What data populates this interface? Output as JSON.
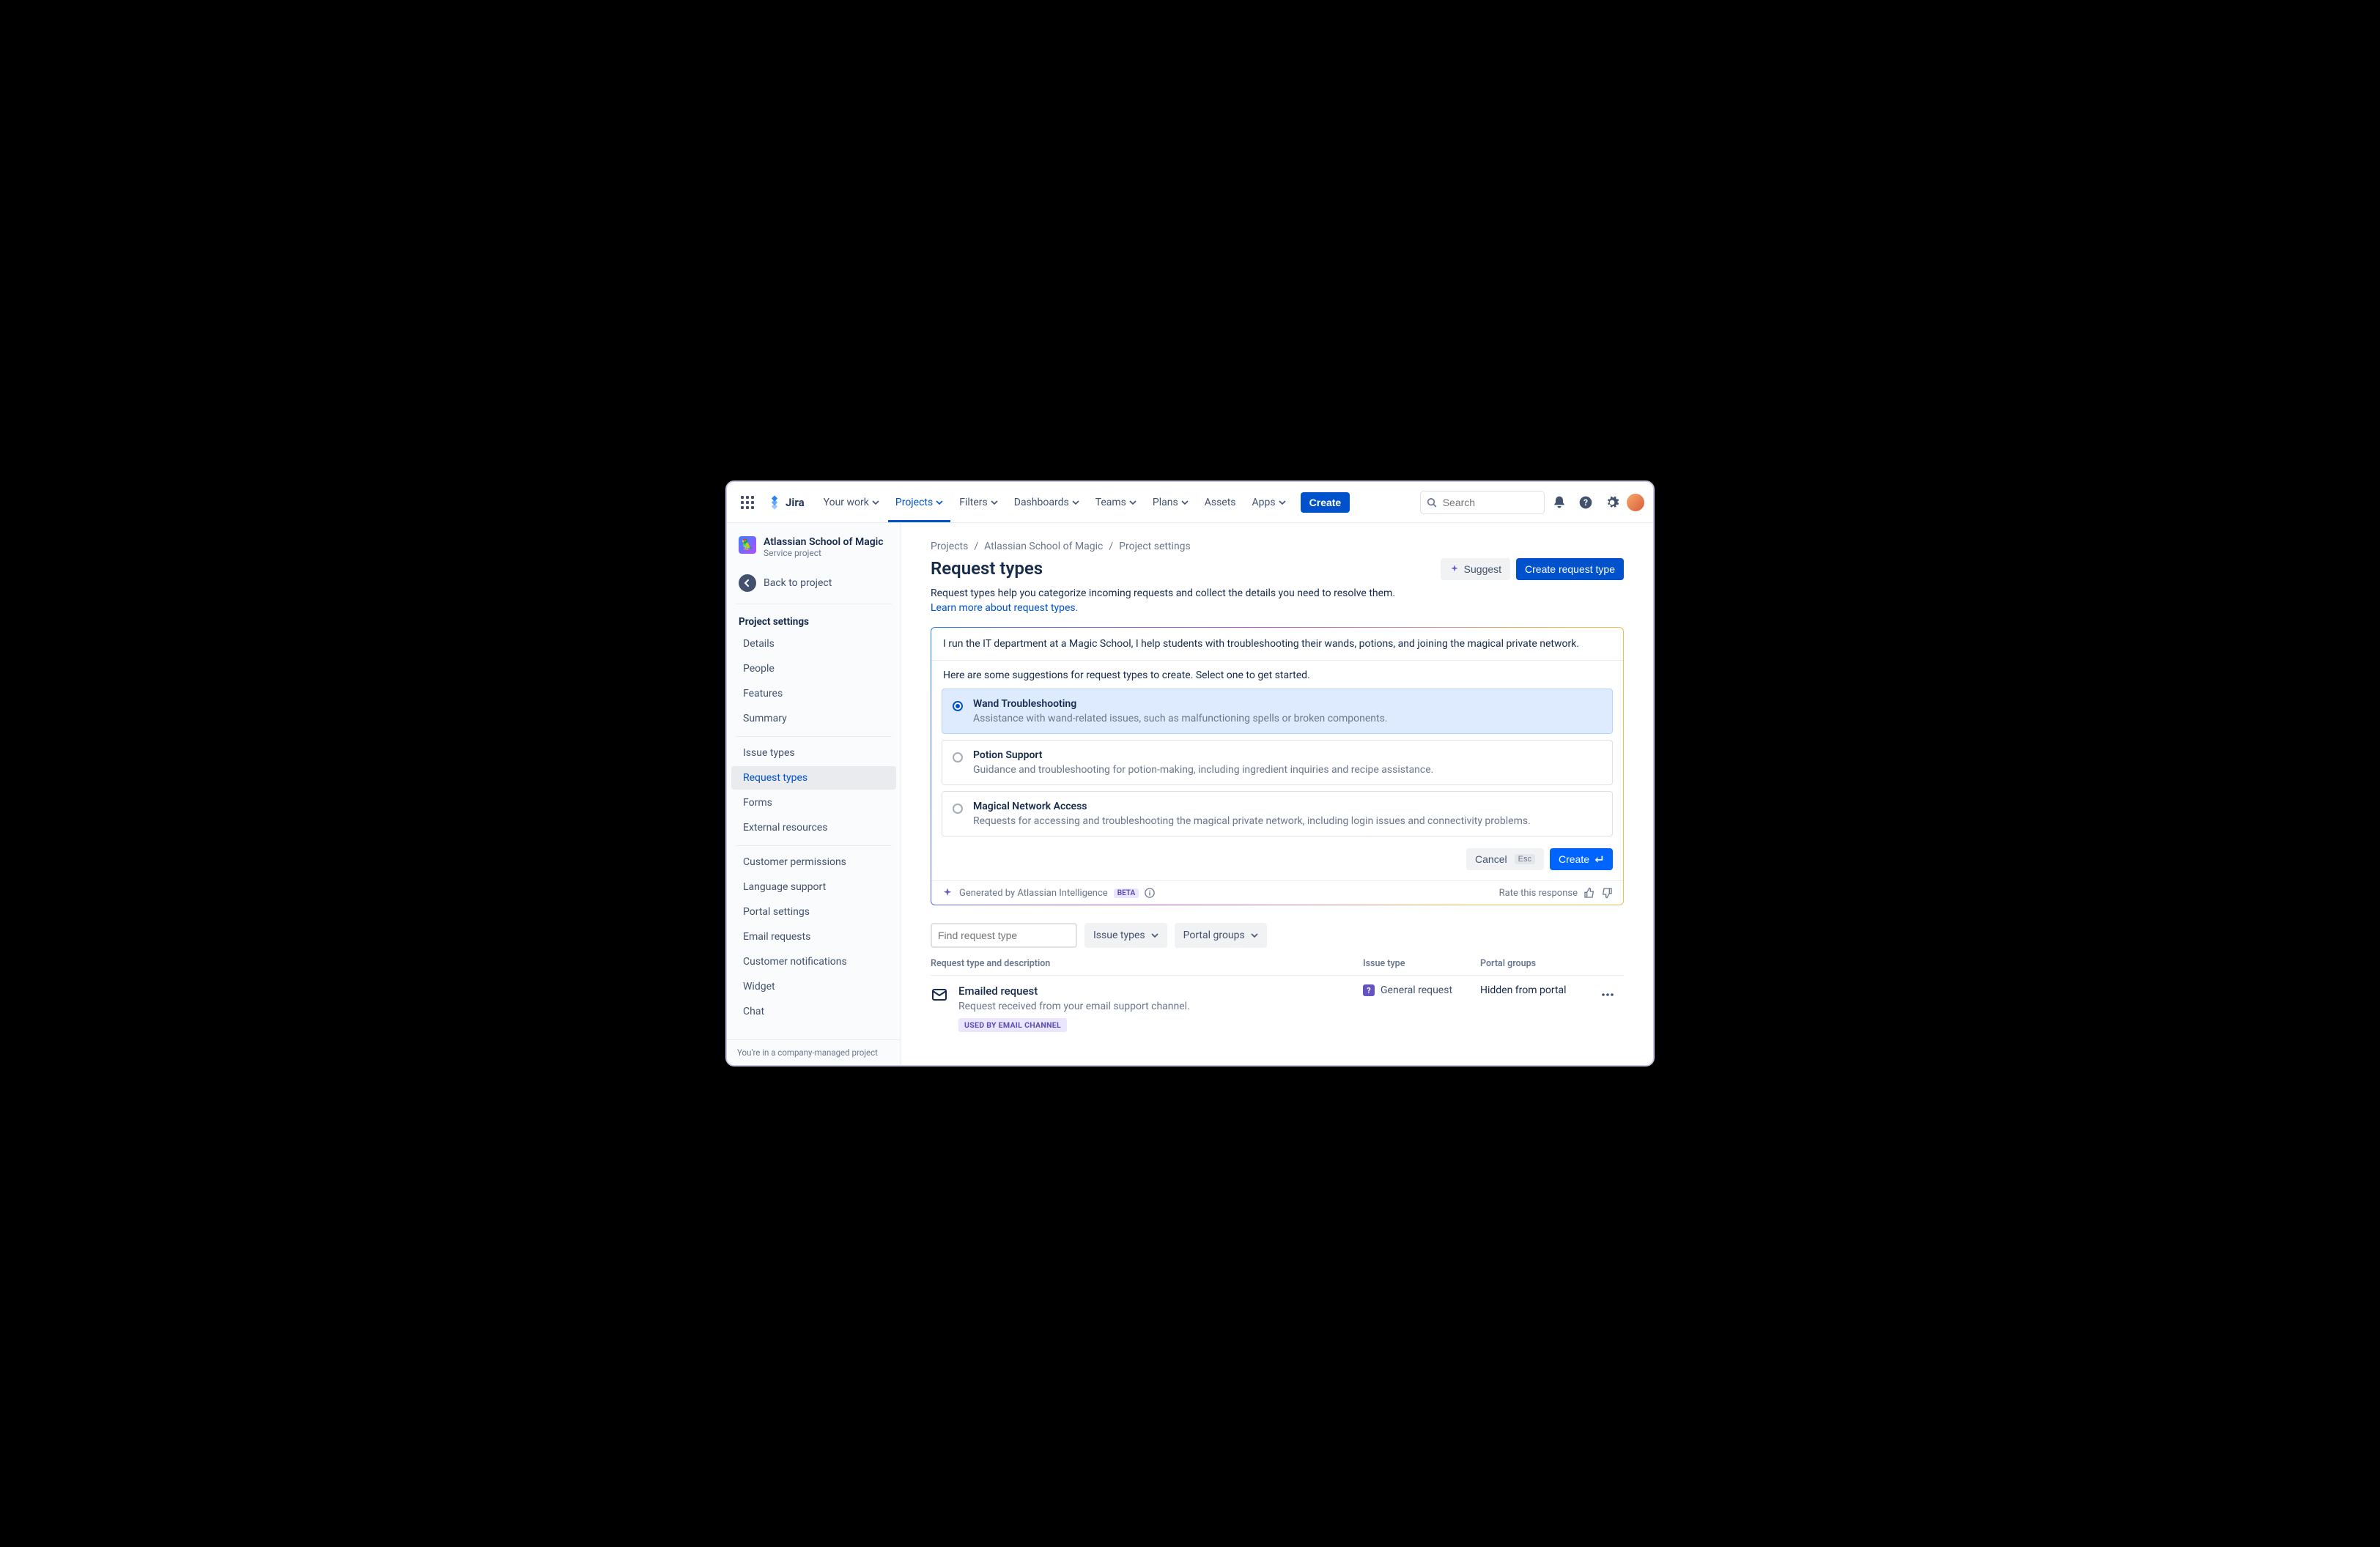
{
  "brand": "Jira",
  "search_placeholder": "Search",
  "nav": {
    "your_work": "Your work",
    "projects": "Projects",
    "filters": "Filters",
    "dashboards": "Dashboards",
    "teams": "Teams",
    "plans": "Plans",
    "assets": "Assets",
    "apps": "Apps",
    "create": "Create"
  },
  "project": {
    "name": "Atlassian School of Magic",
    "type": "Service project",
    "back": "Back to project",
    "footer": "You're in a company-managed project"
  },
  "sidebar": {
    "heading": "Project settings",
    "group1": [
      "Details",
      "People",
      "Features",
      "Summary"
    ],
    "group2": [
      "Issue types",
      "Request types",
      "Forms",
      "External resources"
    ],
    "group3": [
      "Customer permissions",
      "Language support",
      "Portal settings",
      "Email requests",
      "Customer notifications",
      "Widget",
      "Chat"
    ]
  },
  "breadcrumb": [
    "Projects",
    "Atlassian School of Magic",
    "Project settings"
  ],
  "page": {
    "title": "Request types",
    "desc": "Request types help you categorize incoming requests and collect the details you need to resolve them.",
    "learn": "Learn more about request types.",
    "suggest_btn": "Suggest",
    "create_btn": "Create request type"
  },
  "ai": {
    "prompt": "I run the IT department at a Magic School, I help students with troubleshooting their wands, potions, and joining the magical private network.",
    "subheading": "Here are some suggestions for request types to create. Select one to get started.",
    "suggestions": [
      {
        "title": "Wand Troubleshooting",
        "desc": "Assistance with wand-related issues, such as malfunctioning spells or broken components.",
        "selected": true
      },
      {
        "title": "Potion Support",
        "desc": "Guidance and troubleshooting for potion-making, including ingredient inquiries and recipe assistance.",
        "selected": false
      },
      {
        "title": "Magical Network Access",
        "desc": "Requests for accessing and troubleshooting the magical private network, including login issues and connectivity problems.",
        "selected": false
      }
    ],
    "cancel": "Cancel",
    "esc": "Esc",
    "create": "Create",
    "generated": "Generated by Atlassian Intelligence",
    "beta": "BETA",
    "rate": "Rate this response"
  },
  "filters": {
    "find_placeholder": "Find request type",
    "issue_types": "Issue types",
    "portal_groups": "Portal groups"
  },
  "table": {
    "head": {
      "col1": "Request type and description",
      "col2": "Issue type",
      "col3": "Portal groups"
    },
    "row": {
      "title": "Emailed request",
      "desc": "Request received from your email support channel.",
      "chip": "USED BY EMAIL CHANNEL",
      "issue_type": "General request",
      "portal": "Hidden from portal"
    }
  }
}
